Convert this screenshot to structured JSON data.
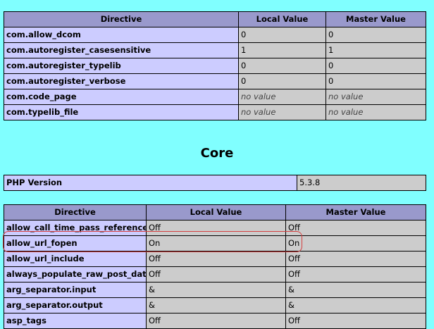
{
  "com_table": {
    "headers": [
      "Directive",
      "Local Value",
      "Master Value"
    ],
    "rows": [
      {
        "directive": "com.allow_dcom",
        "local": "0",
        "master": "0"
      },
      {
        "directive": "com.autoregister_casesensitive",
        "local": "1",
        "master": "1"
      },
      {
        "directive": "com.autoregister_typelib",
        "local": "0",
        "master": "0"
      },
      {
        "directive": "com.autoregister_verbose",
        "local": "0",
        "master": "0"
      },
      {
        "directive": "com.code_page",
        "local": "no value",
        "master": "no value"
      },
      {
        "directive": "com.typelib_file",
        "local": "no value",
        "master": "no value"
      }
    ]
  },
  "core": {
    "title": "Core",
    "version_label": "PHP Version",
    "version_value": "5.3.8"
  },
  "core_table": {
    "headers": [
      "Directive",
      "Local Value",
      "Master Value"
    ],
    "rows": [
      {
        "directive": "allow_call_time_pass_reference",
        "local": "Off",
        "master": "Off"
      },
      {
        "directive": "allow_url_fopen",
        "local": "On",
        "master": "On"
      },
      {
        "directive": "allow_url_include",
        "local": "Off",
        "master": "Off"
      },
      {
        "directive": "always_populate_raw_post_data",
        "local": "Off",
        "master": "Off"
      },
      {
        "directive": "arg_separator.input",
        "local": "&",
        "master": "&"
      },
      {
        "directive": "arg_separator.output",
        "local": "&",
        "master": "&"
      },
      {
        "directive": "asp_tags",
        "local": "Off",
        "master": "Off"
      }
    ]
  },
  "colors": {
    "page_background": "#80ffff",
    "header_background": "#9999cc",
    "directive_background": "#ccccff",
    "value_background": "#cccccc",
    "highlight_outline": "#d54040"
  }
}
